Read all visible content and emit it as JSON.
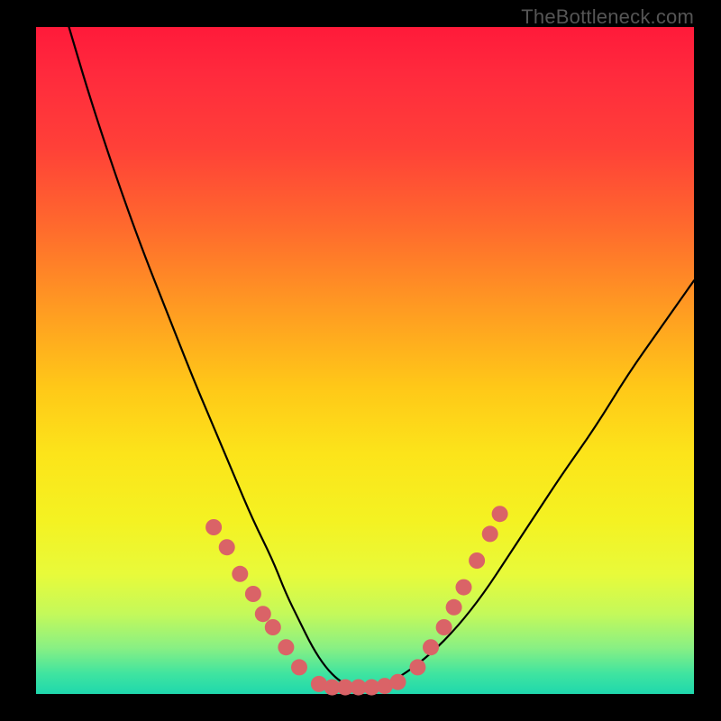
{
  "watermark": "TheBottleneck.com",
  "colors": {
    "frame": "#000000",
    "gradient_top": "#ff1a3a",
    "gradient_bottom": "#1fd8ad",
    "curve": "#000000",
    "dots": "#da6367"
  },
  "chart_data": {
    "type": "line",
    "title": "",
    "xlabel": "",
    "ylabel": "",
    "xlim": [
      0,
      100
    ],
    "ylim": [
      0,
      100
    ],
    "series": [
      {
        "name": "bottleneck-curve",
        "x": [
          5,
          8,
          12,
          16,
          20,
          24,
          27,
          30,
          33,
          36,
          38,
          40,
          42,
          44,
          46,
          48,
          50,
          52,
          54,
          56,
          60,
          64,
          68,
          72,
          76,
          80,
          85,
          90,
          95,
          100
        ],
        "y": [
          100,
          90,
          78,
          67,
          57,
          47,
          40,
          33,
          26,
          20,
          15,
          11,
          7,
          4,
          2,
          1,
          1,
          1,
          2,
          3,
          6,
          10,
          15,
          21,
          27,
          33,
          40,
          48,
          55,
          62
        ]
      }
    ],
    "points": [
      {
        "name": "left-arm-1",
        "x": 27,
        "y": 25
      },
      {
        "name": "left-arm-2",
        "x": 29,
        "y": 22
      },
      {
        "name": "left-arm-3",
        "x": 31,
        "y": 18
      },
      {
        "name": "left-arm-4",
        "x": 33,
        "y": 15
      },
      {
        "name": "left-arm-5",
        "x": 34.5,
        "y": 12
      },
      {
        "name": "left-arm-6",
        "x": 36,
        "y": 10
      },
      {
        "name": "left-arm-7",
        "x": 38,
        "y": 7
      },
      {
        "name": "left-arm-8",
        "x": 40,
        "y": 4
      },
      {
        "name": "trough-1",
        "x": 43,
        "y": 1.5
      },
      {
        "name": "trough-2",
        "x": 45,
        "y": 1
      },
      {
        "name": "trough-3",
        "x": 47,
        "y": 1
      },
      {
        "name": "trough-4",
        "x": 49,
        "y": 1
      },
      {
        "name": "trough-5",
        "x": 51,
        "y": 1
      },
      {
        "name": "trough-6",
        "x": 53,
        "y": 1.2
      },
      {
        "name": "trough-7",
        "x": 55,
        "y": 1.8
      },
      {
        "name": "right-arm-1",
        "x": 58,
        "y": 4
      },
      {
        "name": "right-arm-2",
        "x": 60,
        "y": 7
      },
      {
        "name": "right-arm-3",
        "x": 62,
        "y": 10
      },
      {
        "name": "right-arm-4",
        "x": 63.5,
        "y": 13
      },
      {
        "name": "right-arm-5",
        "x": 65,
        "y": 16
      },
      {
        "name": "right-arm-6",
        "x": 67,
        "y": 20
      },
      {
        "name": "right-arm-7",
        "x": 69,
        "y": 24
      },
      {
        "name": "right-arm-8",
        "x": 70.5,
        "y": 27
      }
    ]
  }
}
